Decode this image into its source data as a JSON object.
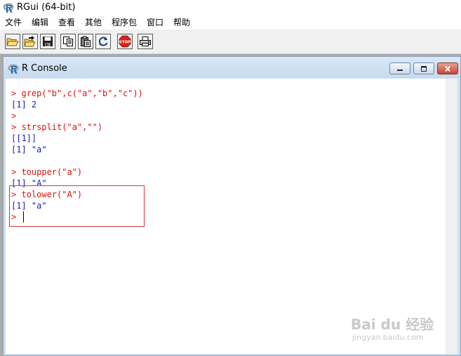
{
  "app": {
    "title": "RGui (64-bit)"
  },
  "menu": [
    "文件",
    "编辑",
    "查看",
    "其他",
    "程序包",
    "窗口",
    "帮助"
  ],
  "toolbar": {
    "buttons": [
      "open-script",
      "load-workspace",
      "save-workspace",
      "copy",
      "paste",
      "copy-paste",
      "stop",
      "print"
    ],
    "stop_label": "STOP"
  },
  "console": {
    "title": "R Console",
    "lines": [
      {
        "kind": "input",
        "text": "> grep(\"b\",c(\"a\",\"b\",\"c\"))"
      },
      {
        "kind": "output",
        "text": "[1] 2"
      },
      {
        "kind": "input",
        "text": ">"
      },
      {
        "kind": "input",
        "text": "> strsplit(\"a\",\"\")"
      },
      {
        "kind": "output",
        "text": "[[1]]"
      },
      {
        "kind": "output",
        "text": "[1] \"a\""
      },
      {
        "kind": "blank",
        "text": ""
      },
      {
        "kind": "input",
        "text": "> toupper(\"a\")"
      },
      {
        "kind": "output",
        "text": "[1] \"A\""
      },
      {
        "kind": "input",
        "text": "> tolower(\"A\")"
      },
      {
        "kind": "output",
        "text": "[1] \"a\""
      },
      {
        "kind": "input",
        "text": ">"
      }
    ]
  },
  "colors": {
    "input": "#e0120d",
    "output": "#1b1bb8",
    "highlight": "#d9363a"
  },
  "watermark": {
    "main": "Bai du 经验",
    "sub": "jingyan.baidu.com"
  }
}
